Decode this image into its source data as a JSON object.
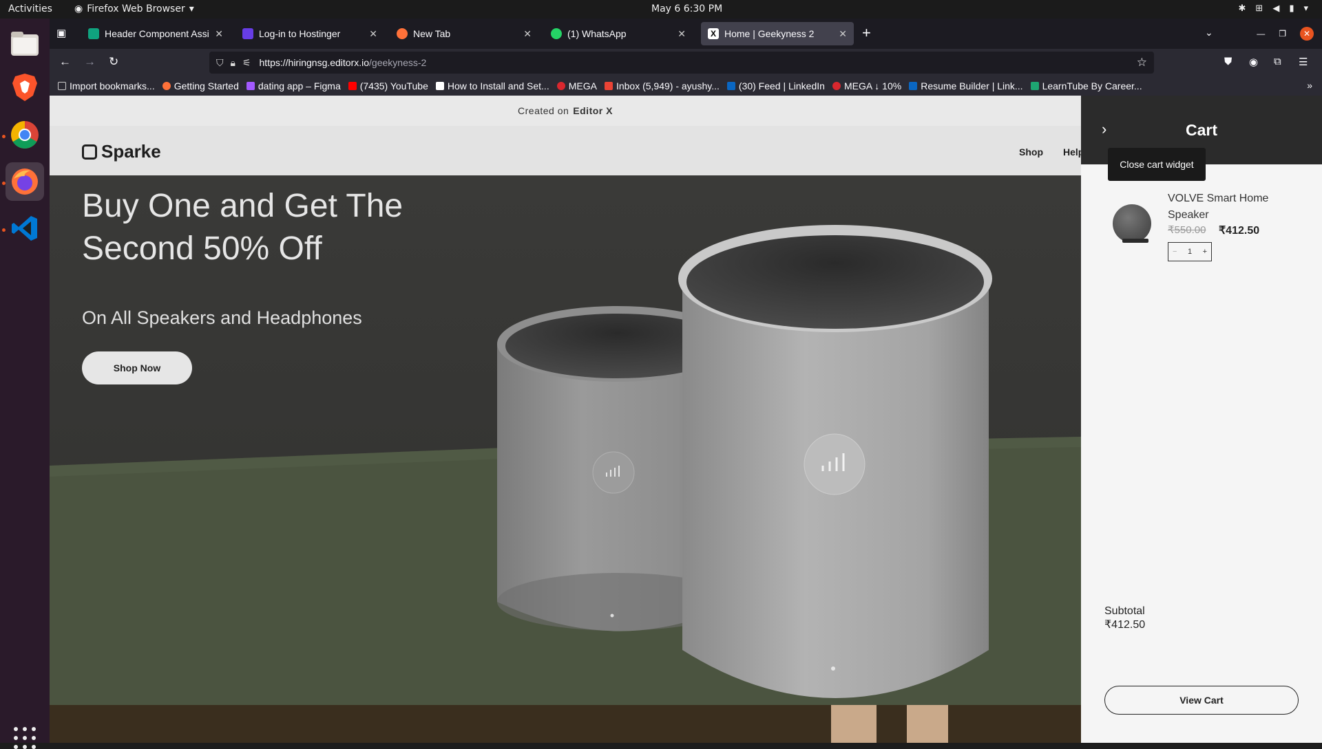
{
  "system": {
    "activities": "Activities",
    "app_menu": "Firefox Web Browser",
    "clock": "May 6  6:30 PM"
  },
  "tabs": [
    {
      "title": "Header Component Assis",
      "color": "#10a37f"
    },
    {
      "title": "Log-in to Hostinger",
      "color": "#673de6"
    },
    {
      "title": "New Tab",
      "color": "#ff7139"
    },
    {
      "title": "(1) WhatsApp",
      "color": "#25d366"
    },
    {
      "title": "Home | Geekyness 2",
      "color": "#ffffff"
    }
  ],
  "url": {
    "host": "https://hiringnsg.editorx.io",
    "path": "/geekyness-2"
  },
  "bookmarks": [
    {
      "label": "Import bookmarks...",
      "color": "#cccccc"
    },
    {
      "label": "Getting Started",
      "color": "#ff7139"
    },
    {
      "label": "dating app – Figma",
      "color": "#a259ff"
    },
    {
      "label": "(7435) YouTube",
      "color": "#ff0000"
    },
    {
      "label": "How to Install and Set...",
      "color": "#ffffff"
    },
    {
      "label": "MEGA",
      "color": "#d9272e"
    },
    {
      "label": "Inbox (5,949) - ayushy...",
      "color": "#ea4335"
    },
    {
      "label": "(30) Feed | LinkedIn",
      "color": "#0a66c2"
    },
    {
      "label": "MEGA ↓ 10%",
      "color": "#d9272e"
    },
    {
      "label": "Resume Builder | Link...",
      "color": "#0a66c2"
    },
    {
      "label": "LearnTube By Career...",
      "color": "#1ea672"
    }
  ],
  "site": {
    "created_on": "Created on",
    "editor": "Editor X",
    "logo": "Sparke",
    "nav_shop": "Shop",
    "nav_help": "Help",
    "hero_title": "Buy One and Get The Second 50% Off",
    "hero_subtitle": "On All Speakers and Headphones",
    "shop_now": "Shop Now"
  },
  "cart": {
    "title": "Cart",
    "tooltip": "Close cart widget",
    "item_name": "VOLVE Smart Home Speaker",
    "original_price": "₹550.00",
    "sale_price": "₹412.50",
    "quantity": "1",
    "subtotal_label": "Subtotal",
    "subtotal_value": "₹412.50",
    "view_cart": "View Cart"
  },
  "colors": {
    "accent": "#e95420",
    "hero_bg": "#363634",
    "table_green": "#4b5440"
  }
}
